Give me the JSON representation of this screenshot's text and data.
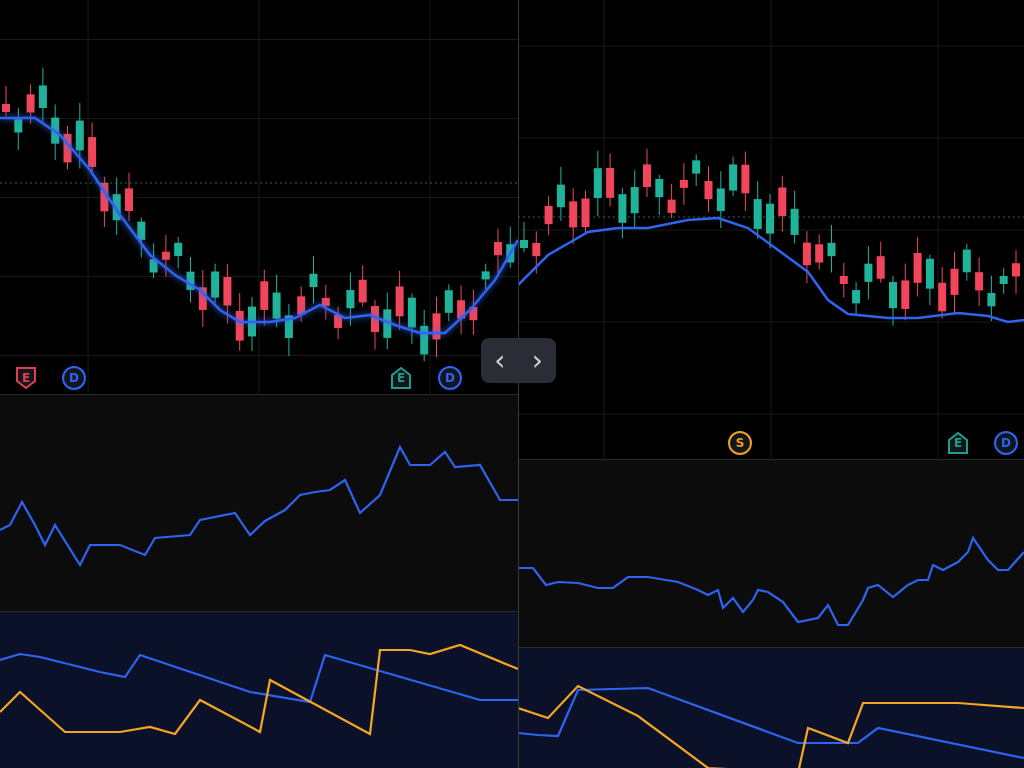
{
  "panes": [
    {
      "markers": [
        {
          "kind": "shield",
          "label": "E",
          "color": "#e0404f"
        },
        {
          "kind": "circle",
          "label": "D",
          "color": "#2f64f2"
        },
        {
          "kind": "house",
          "label": "E",
          "color": "#1f9e8a"
        },
        {
          "kind": "circle",
          "label": "D",
          "color": "#2f64f2"
        }
      ]
    },
    {
      "markers": [
        {
          "kind": "circle",
          "label": "S",
          "color": "#f0a020"
        },
        {
          "kind": "house",
          "label": "E",
          "color": "#1f9e8a"
        },
        {
          "kind": "circle",
          "label": "D",
          "color": "#2f64f2"
        }
      ]
    }
  ],
  "navigation": {
    "previous": "‹",
    "next": "›"
  }
}
